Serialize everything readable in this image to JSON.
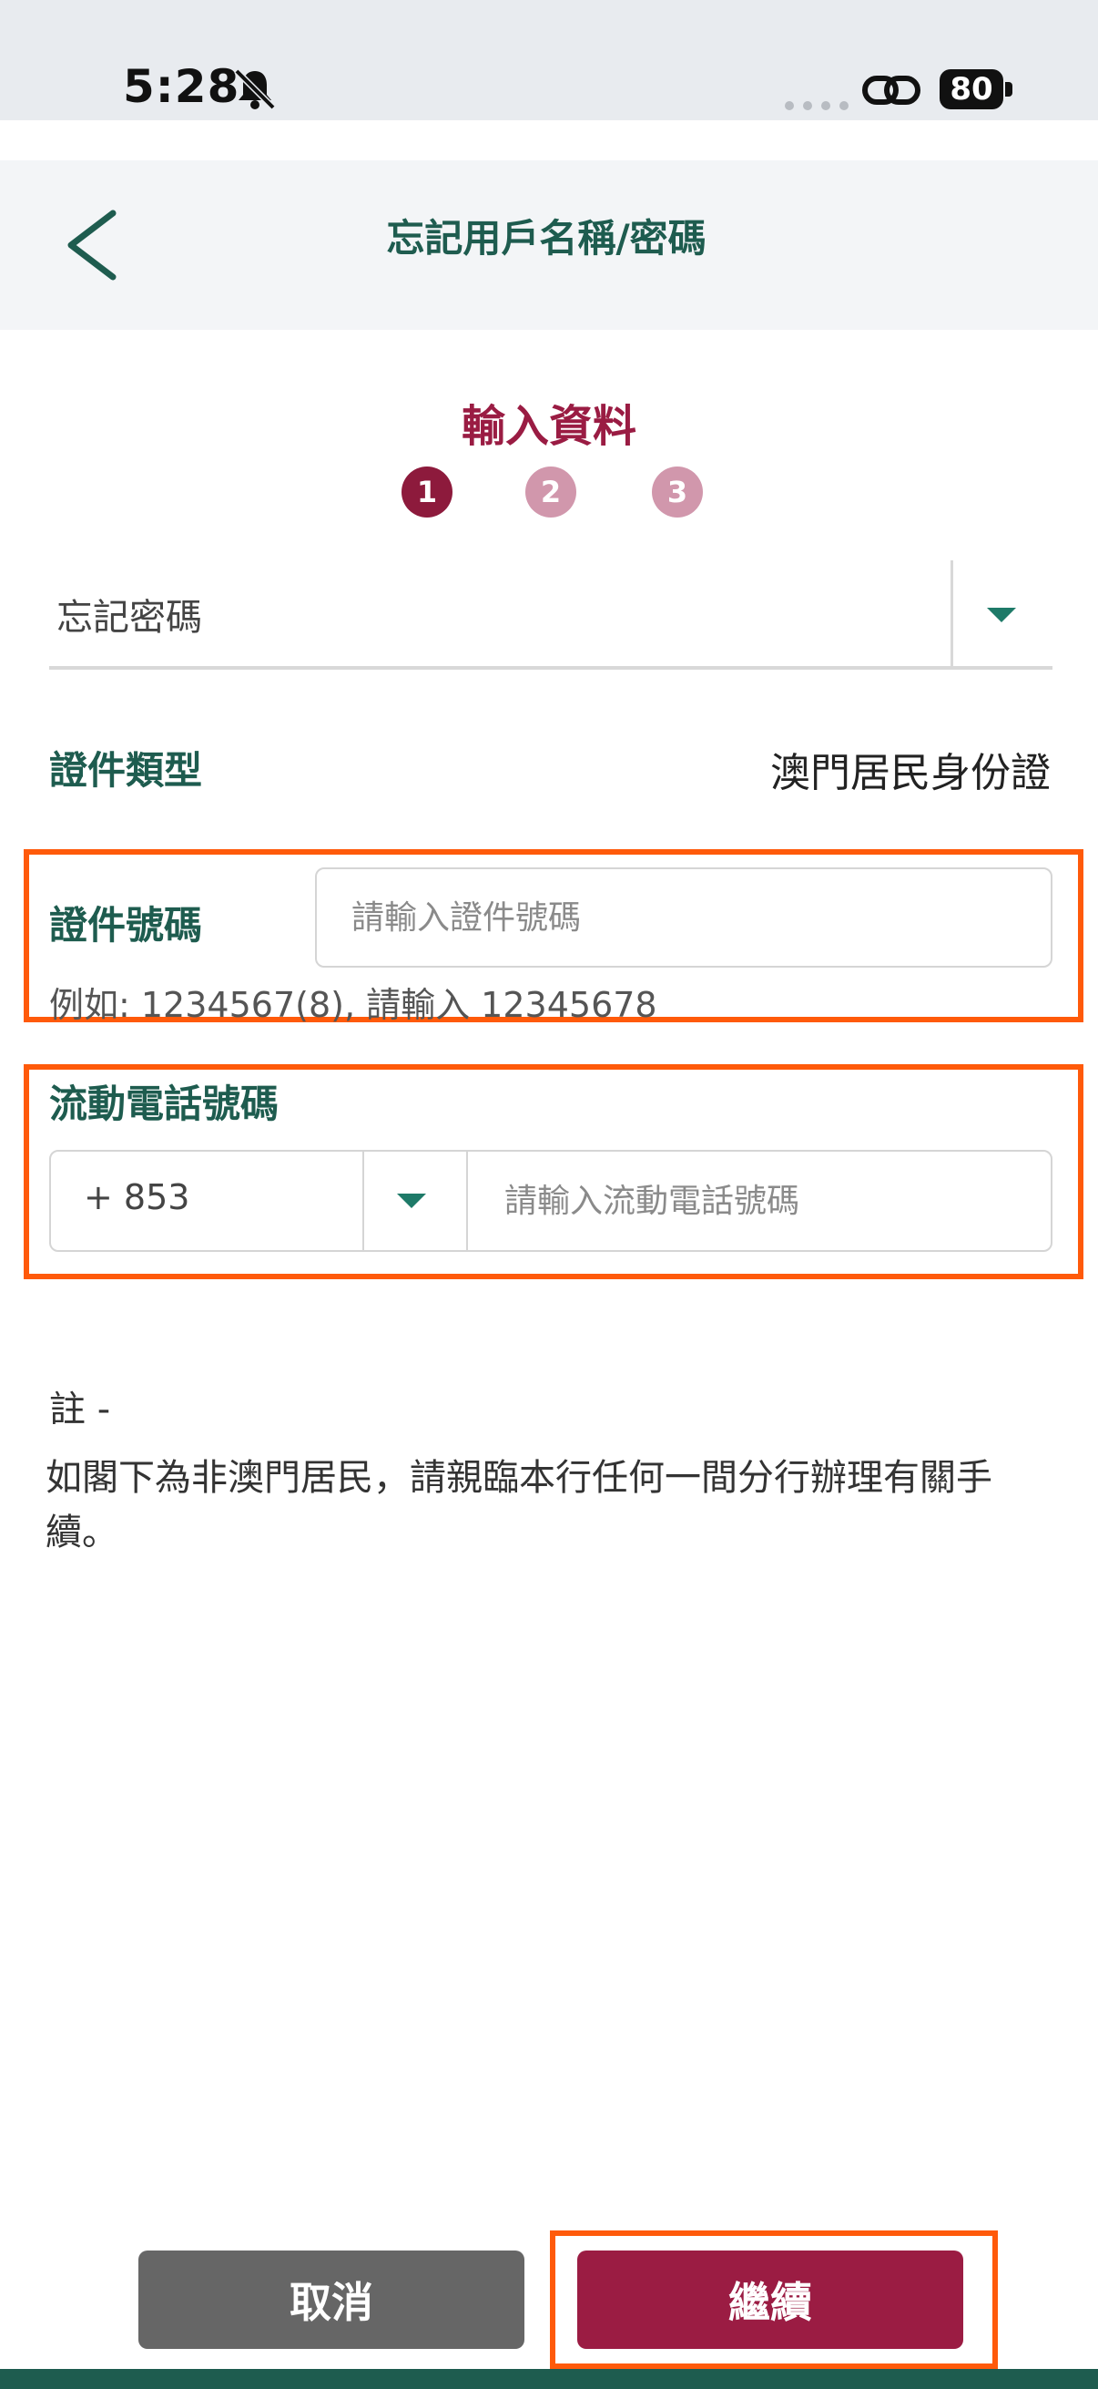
{
  "status_bar": {
    "time": "5:28",
    "battery": "80"
  },
  "header": {
    "title": "忘記用戶名稱/密碼"
  },
  "steps": {
    "title": "輸入資料",
    "items": [
      "1",
      "2",
      "3"
    ],
    "current": 1
  },
  "forgot_select": {
    "value": "忘記密碼"
  },
  "document_type": {
    "label": "證件類型",
    "value": "澳門居民身份證"
  },
  "id_number": {
    "label": "證件號碼",
    "placeholder": "請輸入證件號碼",
    "hint": "例如: 1234567(8), 請輸入 12345678"
  },
  "mobile": {
    "label": "流動電話號碼",
    "country_code": "+ 853",
    "placeholder": "請輸入流動電話號碼"
  },
  "note": {
    "label": "註 -",
    "text": "如閣下為非澳門居民，請親臨本行任何一間分行辦理有關手續。"
  },
  "buttons": {
    "cancel": "取消",
    "continue": "繼續"
  },
  "colors": {
    "brand_green": "#1e5c4f",
    "brand_red": "#9b1c43",
    "highlight": "#ff5a0a"
  }
}
